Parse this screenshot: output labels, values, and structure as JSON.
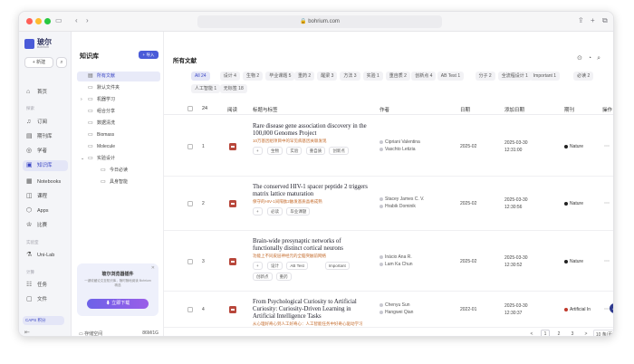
{
  "browser": {
    "url": "bohrium.com"
  },
  "nav": {
    "brand_name": "玻尔",
    "brand_sub": "Bohrium",
    "new_label": "+ 新建",
    "items_top": [
      {
        "label": "首页",
        "icon": "home-icon"
      },
      {
        "label": "订阅",
        "icon": "bell-icon"
      },
      {
        "label": "期刊库",
        "icon": "journal-icon"
      },
      {
        "label": "学者",
        "icon": "scholar-icon"
      },
      {
        "label": "知识库",
        "icon": "library-icon",
        "active": true
      },
      {
        "label": "Notebooks",
        "icon": "notebook-icon"
      },
      {
        "label": "课程",
        "icon": "course-icon"
      },
      {
        "label": "Apps",
        "icon": "apps-icon"
      },
      {
        "label": "比赛",
        "icon": "trophy-icon"
      }
    ],
    "section_explore": "探索",
    "section_lab": "实验室",
    "section_compute": "计算",
    "item_unilab": "Uni-Lab",
    "items_compute": [
      {
        "label": "任务",
        "icon": "task-icon"
      },
      {
        "label": "文件",
        "icon": "file-icon"
      }
    ],
    "capsule": "CAPS 积分"
  },
  "lib": {
    "title": "知识库",
    "import_label": "+ 导入",
    "items": [
      {
        "label": "所有文献",
        "active": true,
        "indent": 0,
        "arrow": ""
      },
      {
        "label": "默认文件夹",
        "indent": 0,
        "arrow": ""
      },
      {
        "label": "机器学习",
        "indent": 0,
        "arrow": ">"
      },
      {
        "label": "组合分享",
        "indent": 0,
        "arrow": ""
      },
      {
        "label": "数据清洗",
        "indent": 0,
        "arrow": ""
      },
      {
        "label": "Biomass",
        "indent": 0,
        "arrow": ""
      },
      {
        "label": "Molecule",
        "indent": 0,
        "arrow": ""
      },
      {
        "label": "实验设计",
        "indent": 0,
        "arrow": "v"
      },
      {
        "label": "今日必读",
        "indent": 1,
        "arrow": ""
      },
      {
        "label": "具身智能",
        "indent": 1,
        "arrow": ""
      }
    ],
    "promo_title": "玻尔浏览器插件",
    "promo_desc": "一键收藏论文至知识库，随时随地阅读 Bohrium 精选",
    "promo_button": "立即下载",
    "storage_label": "存储空间",
    "storage_value": "86M/1G"
  },
  "main": {
    "title": "所有文献",
    "tags": [
      {
        "label": "All 24",
        "active": true
      },
      {
        "label": "设计 4"
      },
      {
        "label": "生物 2"
      },
      {
        "label": "毕业课题 5"
      },
      {
        "label": "重药 2"
      },
      {
        "label": "醒梁 3"
      },
      {
        "label": "方法 3"
      },
      {
        "label": "实验 1"
      },
      {
        "label": "重自质 2"
      },
      {
        "label": "创新点 4"
      },
      {
        "label": "AB Test 1"
      },
      {
        "label": "分子 2"
      },
      {
        "label": "全流程设计 1"
      },
      {
        "label": "Important 1"
      },
      {
        "label": "必读 2"
      },
      {
        "label": "人工智能 1"
      },
      {
        "label": "无标签 18"
      }
    ],
    "headers": {
      "count": "24",
      "read": "阅读",
      "title": "标题与标签",
      "authors": "作者",
      "date": "日期",
      "added": "添加日期",
      "journal": "期刊",
      "ops": "操作"
    },
    "rows": [
      {
        "num": "1",
        "title": "Rare disease gene association discovery in the 100,000 Genomes Project",
        "subtitle": "10万基因组项目中的罕见病基因关联发现",
        "chips": [
          "+",
          "生物",
          "实验",
          "重自质",
          "创新点"
        ],
        "authors": [
          "Cipriani Valentina",
          "Vaschto Letizia"
        ],
        "date": "2025-02",
        "added_date": "2025-03-30",
        "added_time": "12:31:00",
        "journal": "Nature"
      },
      {
        "num": "2",
        "title": "The conserved HIV-1 spacer peptide 2 triggers matrix lattice maturation",
        "subtitle": "保守的HIV-1间隔肽2触发基质晶格成熟",
        "chips": [
          "+",
          "必读",
          "毕业课题"
        ],
        "authors": [
          "Stacey James C. V.",
          "Hrabik Dominik"
        ],
        "date": "2025-02",
        "added_date": "2025-03-30",
        "added_time": "12:30:56",
        "journal": "Nature"
      },
      {
        "num": "3",
        "title": "Brain-wide presynaptic networks of functionally distinct cortical neurons",
        "subtitle": "功能上不同皮层神经元的全脑突触前网络",
        "chips": [
          "+",
          "设计",
          "AB Test",
          "Important",
          "创新点",
          "重药"
        ],
        "authors": [
          "Inácio Ana R.",
          "Lam Ka Chun"
        ],
        "date": "2025-02",
        "added_date": "2025-03-30",
        "added_time": "12:30:52",
        "journal": "Nature"
      },
      {
        "num": "4",
        "title": "From Psychological Curiosity to Artificial Curiosity: Curiosity-Driven Learning in Artificial Intelligence Tasks",
        "subtitle": "从心理好奇心到人工好奇心：人工智能任务中好奇心驱动学习",
        "chips": [],
        "authors": [
          "Chenyu Sun",
          "Hangwei Qian"
        ],
        "date": "2022-01",
        "added_date": "2025-03-30",
        "added_time": "12:30:37",
        "journal": "Artificial In"
      }
    ],
    "pagination": {
      "prev": "<",
      "pages": [
        "1",
        "2",
        "3"
      ],
      "next": ">",
      "size": "10 条/页"
    },
    "ai_badge": "AI"
  }
}
